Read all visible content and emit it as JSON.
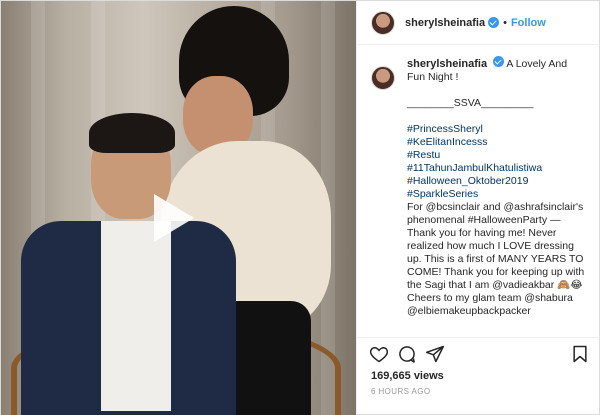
{
  "header": {
    "username": "sherylsheinafia",
    "separator": "•",
    "follow_label": "Follow"
  },
  "caption": {
    "username": "sherylsheinafia",
    "lines": [
      "A Lovely And Fun Night !",
      "",
      "________SSVA_________",
      "",
      "#PrincessSheryl",
      "#KeElitanIncesss",
      "#Restu",
      "#11TahunJambulKhatulistiwa",
      "#Halloween_Oktober2019",
      "#SparkleSeries",
      "For @bcsinclair and @ashrafsinclair's phenomenal #HalloweenParty — Thank you for having me! Never realized how much I LOVE dressing up. This is a first of MANY YEARS TO COME! Thank you for keeping up with the Sagi that I am @vadieakbar 🙈😂 Cheers to my glam team @shabura @elbiemakeupbackpacker"
    ]
  },
  "stats": {
    "views": "169,665 views",
    "time": "6 HOURS AGO"
  },
  "icons": {
    "like": "heart-icon",
    "comment": "comment-icon",
    "share": "share-icon",
    "save": "bookmark-icon",
    "play": "play-icon",
    "verified": "verified-badge-icon"
  },
  "colors": {
    "accent": "#3897f0",
    "link": "#003569",
    "muted": "#999999"
  }
}
